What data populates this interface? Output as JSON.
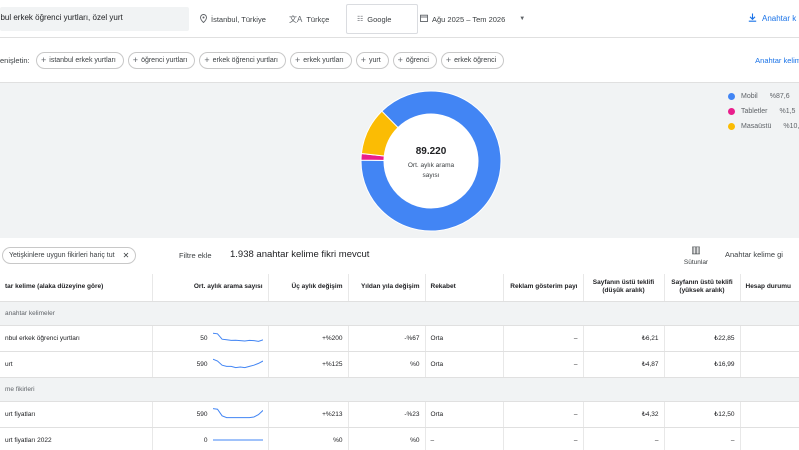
{
  "filters": {
    "keywords": "nbul erkek öğrenci yurtları, özel yurt",
    "location": "İstanbul, Türkiye",
    "language": "Türkçe",
    "engine": "Google",
    "date_range": "Ağu 2025 – Tem 2026",
    "download": "Anahtar k"
  },
  "broaden": {
    "label": "enişletin:",
    "chips": [
      "istanbul erkek yurtları",
      "öğrenci yurtları",
      "erkek öğrenci yurtları",
      "erkek yurtları",
      "yurt",
      "öğrenci",
      "erkek öğrenci"
    ],
    "add_link": "Anahtar kelim"
  },
  "chart": {
    "center_value": "89.220",
    "center_label_1": "Ort. aylık arama",
    "center_label_2": "sayısı",
    "legend": [
      {
        "name": "Mobil",
        "pct": "%87,6",
        "color": "#4285f4"
      },
      {
        "name": "Tabletler",
        "pct": "%1,5",
        "color": "#e91e8c"
      },
      {
        "name": "Masaüstü",
        "pct": "%10,9",
        "color": "#fbbc04"
      }
    ]
  },
  "chart_data": {
    "type": "pie",
    "categories": [
      "Mobil",
      "Tabletler",
      "Masaüstü"
    ],
    "values": [
      87.6,
      1.5,
      10.9
    ],
    "title": "",
    "donut": true
  },
  "toolbar": {
    "filter_chip": "Yetişkinlere uygun fikirleri hariç tut",
    "add_filter": "Filtre ekle",
    "ideas_count": "1.938 anahtar kelime fikri mevcut",
    "columns": "Sütunlar",
    "keyword_btn": "Anahtar kelime gi"
  },
  "table": {
    "headers": [
      "tar kelime (alaka düzeyine göre)",
      "Ort. aylık arama sayısı",
      "Üç aylık değişim",
      "Yıldan yıla değişim",
      "Rekabet",
      "Reklam gösterim payı",
      "Sayfanın üstü teklifi (düşük aralık)",
      "Sayfanın üstü teklifi (yüksek aralık)",
      "Hesap durumu"
    ],
    "group1": "anahtar kelimeler",
    "group2": "me fikirleri",
    "rows1": [
      {
        "kw": "nbul erkek öğrenci yurtları",
        "vol": "50",
        "q": "+%200",
        "y": "-%67",
        "comp": "Orta",
        "share": "–",
        "low": "₺6,21",
        "high": "₺22,85",
        "spark": [
          0.9,
          0.85,
          0.4,
          0.35,
          0.3,
          0.32,
          0.28,
          0.25,
          0.3,
          0.28,
          0.22,
          0.35
        ]
      },
      {
        "kw": "urt",
        "vol": "590",
        "q": "+%125",
        "y": "%0",
        "comp": "Orta",
        "share": "–",
        "low": "₺4,87",
        "high": "₺16,99",
        "spark": [
          0.9,
          0.75,
          0.4,
          0.3,
          0.3,
          0.2,
          0.25,
          0.2,
          0.3,
          0.4,
          0.55,
          0.75
        ]
      }
    ],
    "rows2": [
      {
        "kw": "urt fiyatları",
        "vol": "590",
        "q": "+%213",
        "y": "-%23",
        "comp": "Orta",
        "share": "–",
        "low": "₺4,32",
        "high": "₺12,50",
        "spark": [
          0.95,
          0.9,
          0.35,
          0.2,
          0.2,
          0.2,
          0.2,
          0.2,
          0.2,
          0.25,
          0.45,
          0.8
        ]
      },
      {
        "kw": "urt fiyatları 2022",
        "vol": "0",
        "q": "%0",
        "y": "%0",
        "comp": "–",
        "share": "–",
        "low": "–",
        "high": "–",
        "spark": [
          0.5,
          0.5,
          0.5,
          0.5,
          0.5,
          0.5,
          0.5,
          0.5,
          0.5,
          0.5,
          0.5,
          0.5
        ]
      }
    ]
  }
}
